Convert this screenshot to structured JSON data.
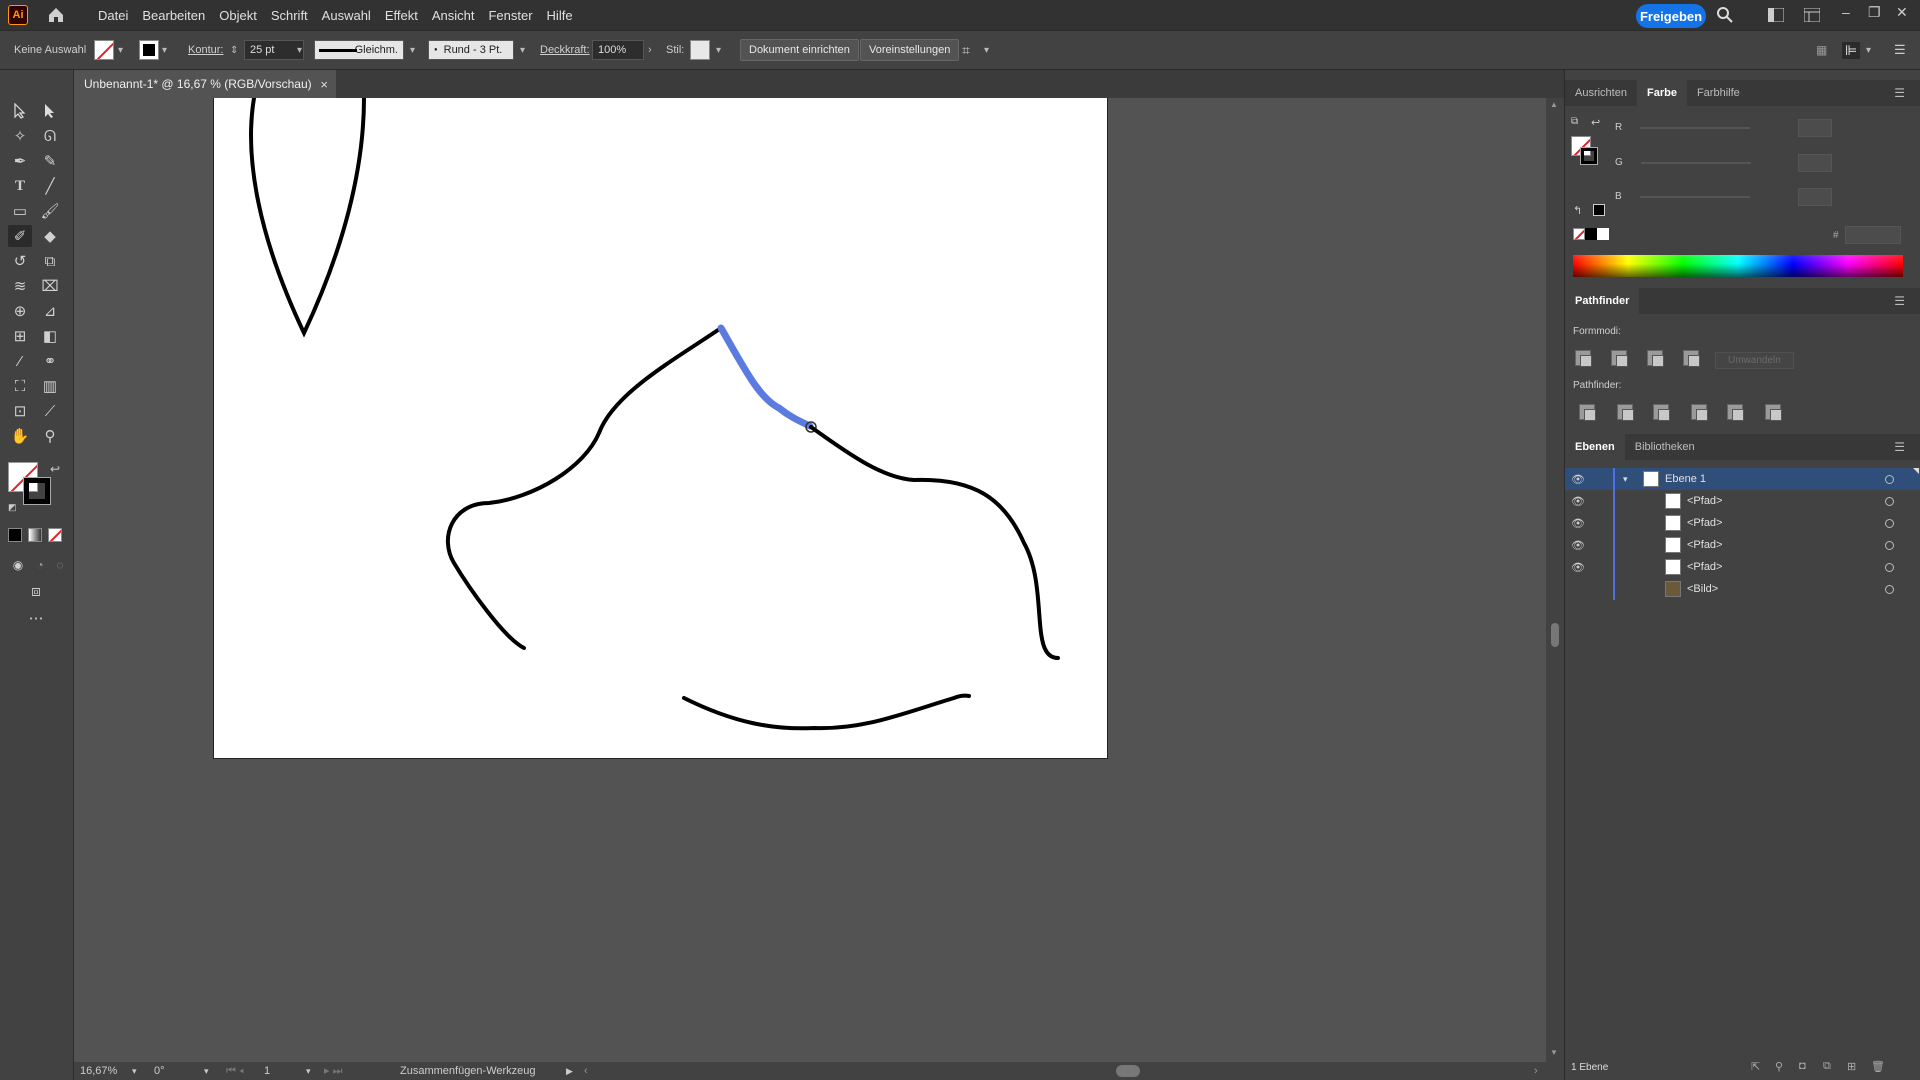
{
  "menubar": {
    "app_logo": "Ai",
    "items": [
      "Datei",
      "Bearbeiten",
      "Objekt",
      "Schrift",
      "Auswahl",
      "Effekt",
      "Ansicht",
      "Fenster",
      "Hilfe"
    ],
    "share_label": "Freigeben"
  },
  "control": {
    "selection_label": "Keine Auswahl",
    "stroke_label": "Kontur:",
    "stroke_value": "25 pt",
    "stroke_profile": "Gleichm.",
    "brush": "Rund - 3 Pt.",
    "opacity_label": "Deckkraft:",
    "opacity_value": "100%",
    "style_label": "Stil:",
    "doc_setup_btn": "Dokument einrichten",
    "prefs_btn": "Voreinstellungen"
  },
  "document": {
    "tab_title": "Unbenannt-1* @ 16,67 % (RGB/Vorschau)",
    "tab_close": "×"
  },
  "status": {
    "zoom": "16,67%",
    "rotation": "0°",
    "artboard": "1",
    "tool_name": "Zusammenfügen-Werkzeug"
  },
  "panels": {
    "color_tabs": [
      "Ausrichten",
      "Farbe",
      "Farbhilfe"
    ],
    "rgb_labels": [
      "R",
      "G",
      "B"
    ],
    "hex_symbol": "#",
    "pathfinder_title": "Pathfinder",
    "shape_modes_label": "Formmodi:",
    "expand_label": "Umwandeln",
    "pathfinders_label": "Pathfinder:",
    "layers_tabs": [
      "Ebenen",
      "Bibliotheken"
    ],
    "layers": [
      {
        "name": "Ebene 1"
      },
      {
        "name": "<Pfad>"
      },
      {
        "name": "<Pfad>"
      },
      {
        "name": "<Pfad>"
      },
      {
        "name": "<Pfad>"
      },
      {
        "name": "<Bild>"
      }
    ],
    "layer_count": "1 Ebene"
  },
  "colors": {
    "accent": "#1473e6",
    "selected_path": "#5b7be0",
    "layer_color": "#4f6ee0"
  }
}
